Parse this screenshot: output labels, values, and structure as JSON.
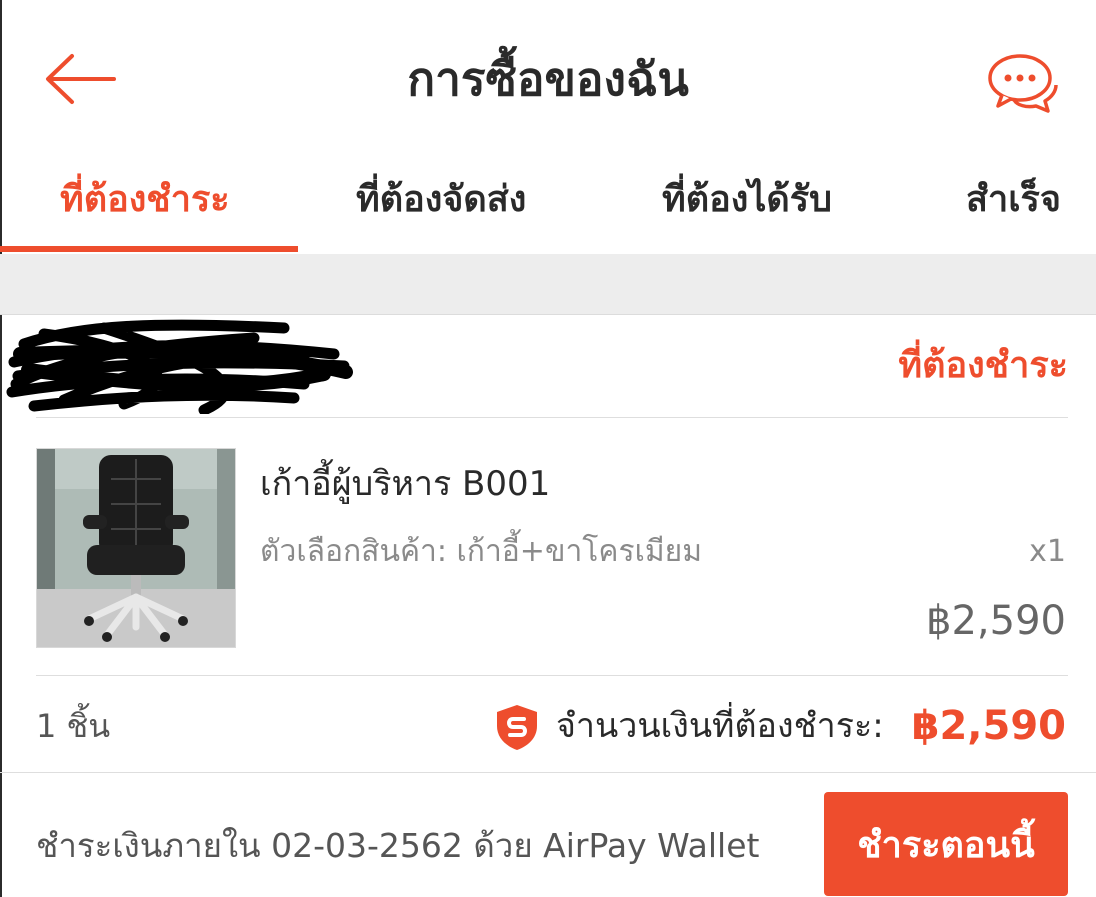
{
  "header": {
    "title": "การซื้อของฉัน",
    "back_icon": "back-arrow-icon",
    "chat_icon": "chat-bubbles-icon"
  },
  "tabs": [
    {
      "label": "ที่ต้องชำระ",
      "active": true
    },
    {
      "label": "ที่ต้องจัดส่ง",
      "active": false
    },
    {
      "label": "ที่ต้องได้รับ",
      "active": false
    },
    {
      "label": "สำเร็จ",
      "active": false
    }
  ],
  "order": {
    "status": "ที่ต้องชำระ",
    "product": {
      "name": "เก้าอี้ผู้บริหาร B001",
      "variant": "ตัวเลือกสินค้า: เก้าอี้+ขาโครเมียม",
      "quantity": "x1",
      "price": "฿2,590"
    },
    "item_count": "1 ชิ้น",
    "total_label": "จำนวนเงินที่ต้องชำระ:",
    "total_amount": "฿2,590",
    "payment_note": "ชำระเงินภายใน 02-03-2562 ด้วย AirPay Wallet",
    "pay_button": "ชำระตอนนี้"
  },
  "colors": {
    "accent": "#ee4d2d",
    "text": "#2a2a2a",
    "muted": "#8a8a8a",
    "band": "#ededed"
  }
}
